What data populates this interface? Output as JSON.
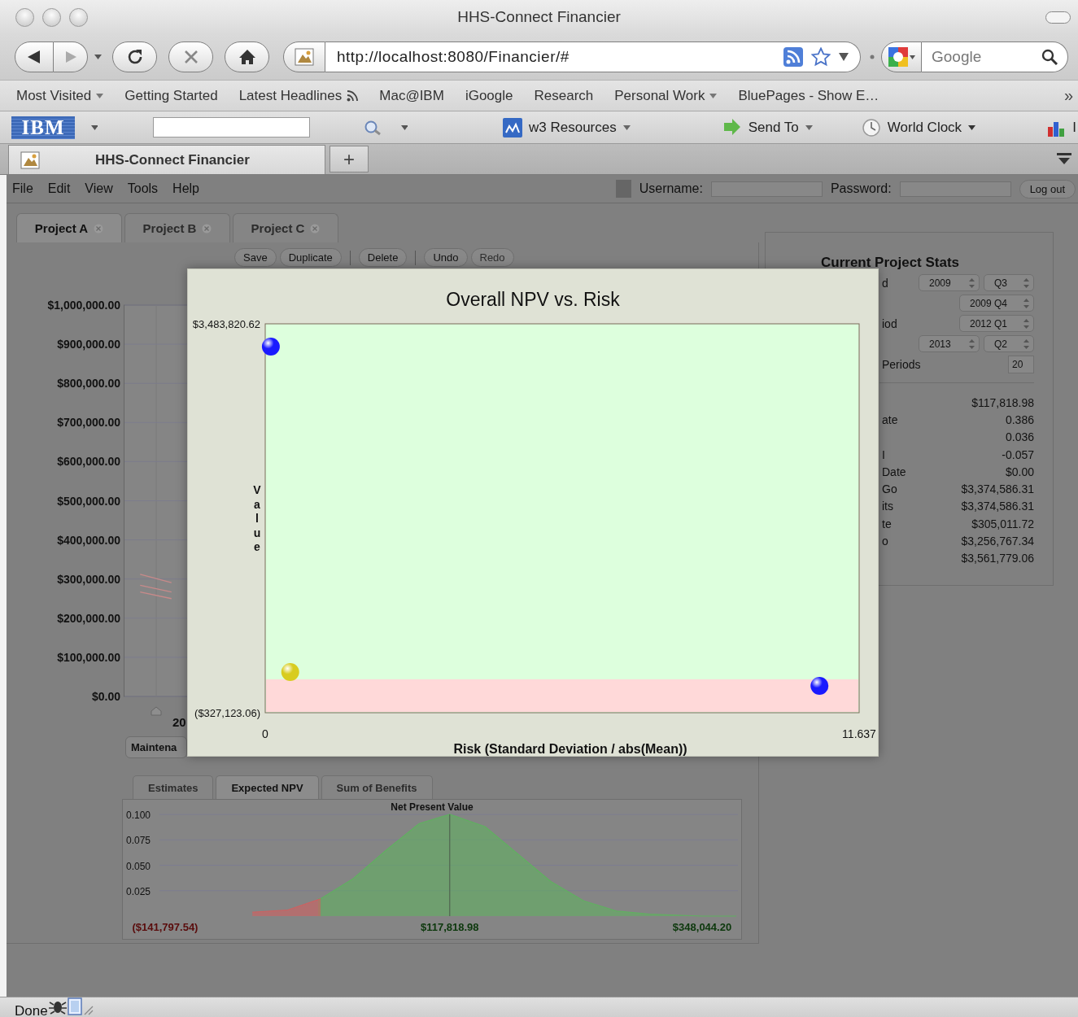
{
  "window": {
    "title": "HHS-Connect Financier"
  },
  "navigation": {
    "url": "http://localhost:8080/Financier/#",
    "search": {
      "placeholder": "Google"
    }
  },
  "bookmarks": [
    {
      "label": "Most Visited",
      "kind": "menu"
    },
    {
      "label": "Getting Started",
      "kind": "link"
    },
    {
      "label": "Latest Headlines",
      "kind": "feed"
    },
    {
      "label": "Mac@IBM",
      "kind": "link"
    },
    {
      "label": "iGoogle",
      "kind": "link"
    },
    {
      "label": "Research",
      "kind": "link"
    },
    {
      "label": "Personal Work",
      "kind": "menu"
    },
    {
      "label": "BluePages - Show E…",
      "kind": "link"
    }
  ],
  "bookmarks_more": "»",
  "ibm_toolbar": {
    "logo": "IBM",
    "items": [
      {
        "label": "w3 Resources",
        "kind": "w3"
      },
      {
        "label": "Send To",
        "kind": "send"
      },
      {
        "label": "World Clock",
        "kind": "clock"
      }
    ],
    "cut_text": "I"
  },
  "tabs": [
    {
      "label": "HHS-Connect Financier",
      "selected": true
    }
  ],
  "new_tab": "+",
  "app": {
    "menu": [
      "File",
      "Edit",
      "View",
      "Tools",
      "Help"
    ],
    "login": {
      "username_label": "Username:",
      "password_label": "Password:",
      "logout": "Log out"
    },
    "projects": [
      {
        "label": "Project A",
        "selected": true
      },
      {
        "label": "Project B",
        "selected": false
      },
      {
        "label": "Project C",
        "selected": false
      }
    ],
    "actions": [
      {
        "kind": "button",
        "label": "Save",
        "disabled": false
      },
      {
        "kind": "button",
        "label": "Duplicate",
        "disabled": false
      },
      {
        "kind": "separator"
      },
      {
        "kind": "button",
        "label": "Delete",
        "disabled": false
      },
      {
        "kind": "separator"
      },
      {
        "kind": "button",
        "label": "Undo",
        "disabled": false
      },
      {
        "kind": "button",
        "label": "Redo",
        "disabled": true
      }
    ],
    "timeline_chart": {
      "chart_data": {
        "type": "line",
        "ylim": [
          0,
          1000000
        ],
        "grid": true,
        "yticks": [
          {
            "value": 1000000,
            "label": "$1,000,000.00"
          },
          {
            "value": 900000,
            "label": "$900,000.00"
          },
          {
            "value": 800000,
            "label": "$800,000.00"
          },
          {
            "value": 700000,
            "label": "$700,000.00"
          },
          {
            "value": 600000,
            "label": "$600,000.00"
          },
          {
            "value": 500000,
            "label": "$500,000.00"
          },
          {
            "value": 400000,
            "label": "$400,000.00"
          },
          {
            "value": 300000,
            "label": "$300,000.00"
          },
          {
            "value": 200000,
            "label": "$200,000.00"
          },
          {
            "value": 100000,
            "label": "$100,000.00"
          },
          {
            "value": 0,
            "label": "$0.00"
          }
        ],
        "series": [
          {
            "color": "#c88a8a",
            "values": [
              312000,
              291000
            ]
          },
          {
            "color": "#c88a8a",
            "values": [
              267000,
              250000
            ]
          },
          {
            "color": "#c88a8a",
            "values": [
              284000,
              267000
            ]
          }
        ]
      },
      "x_label_cut": "20"
    },
    "maintenance_button": "Maintena",
    "result_tabs": [
      {
        "label": "Estimates",
        "selected": false
      },
      {
        "label": "Expected NPV",
        "selected": true
      },
      {
        "label": "Sum of Benefits",
        "selected": false
      }
    ],
    "npv_chart": {
      "chart_data": {
        "type": "area",
        "title": "Net Present Value",
        "grid": true,
        "x": [
          -60000,
          -30000,
          0,
          30000,
          60000,
          90000,
          117818.98,
          150000,
          180000,
          210000,
          240000,
          270000,
          300000,
          348044.2,
          379200
        ],
        "xlim": [
          -177400,
          379200
        ],
        "ylim": [
          0,
          0.1
        ],
        "yticks": [
          {
            "value": 0.1,
            "label": "0.100"
          },
          {
            "value": 0.075,
            "label": "0.075"
          },
          {
            "value": 0.05,
            "label": "0.050"
          },
          {
            "value": 0.025,
            "label": "0.025"
          }
        ],
        "xticks": [
          {
            "value": -141797.54,
            "label": "($141,797.54)"
          },
          {
            "value": 117818.98,
            "label": "$117,818.98"
          },
          {
            "value": 348044.2,
            "label": "$348,044.20"
          }
        ],
        "ref_lines": [
          {
            "axis": "x",
            "value": 117818.98
          }
        ],
        "series": [
          {
            "color": "#d06060",
            "values": [
              0.004,
              0.006,
              0.017,
              null,
              null,
              null,
              null,
              null,
              null,
              null,
              null,
              null,
              null,
              null,
              null
            ]
          },
          {
            "color": "#60b060",
            "values": [
              null,
              null,
              0.017,
              0.037,
              0.065,
              0.091,
              0.1,
              0.088,
              0.061,
              0.034,
              0.015,
              0.005,
              0.002,
              0,
              0
            ]
          }
        ]
      }
    },
    "stats": {
      "title": "Current Project Stats",
      "settings": [
        {
          "kind": "year_quarter",
          "label": "d",
          "year": "2009",
          "quarter": "Q3"
        },
        {
          "kind": "period",
          "value": "2009 Q4"
        },
        {
          "kind": "period",
          "label": "iod",
          "value": "2012 Q1"
        },
        {
          "kind": "year_quarter",
          "year": "2013",
          "quarter": "Q2"
        },
        {
          "kind": "number",
          "label": "Periods",
          "value": "20"
        }
      ],
      "values": [
        {
          "value": "$117,818.98"
        },
        {
          "label": "ate",
          "value": "0.386"
        },
        {
          "value": "0.036"
        },
        {
          "label": "I",
          "value": "-0.057"
        },
        {
          "label": "Date",
          "value": "$0.00"
        },
        {
          "label": "Go",
          "value": "$3,374,586.31"
        },
        {
          "label": "its",
          "value": "$3,374,586.31"
        },
        {
          "label": "te",
          "value": "$305,011.72"
        },
        {
          "label": "o",
          "value": "$3,256,767.34"
        },
        {
          "value": "$3,561,779.06"
        }
      ]
    }
  },
  "risk_chart": {
    "chart_data": {
      "type": "scatter",
      "title": "Overall NPV vs. Risk",
      "xlabel": "Risk (Standard Deviation / abs(Mean))",
      "ylabel": "Value",
      "x": [
        0.11,
        0.49,
        10.86
      ],
      "xlim": [
        0,
        11.637
      ],
      "ylim": [
        -327123.06,
        3483820.62
      ],
      "xticks": [
        {
          "value": 0,
          "label": "0"
        },
        {
          "value": 11.637,
          "label": "11.637"
        }
      ],
      "yticks": [
        {
          "value": 3483820.62,
          "label": "$3,483,820.62"
        },
        {
          "value": -327123.06,
          "label": "($327,123.06)"
        }
      ],
      "series": [
        {
          "color": "#1a1aff",
          "values": [
            3260000,
            null,
            -64000
          ]
        },
        {
          "color": "#d8cc20",
          "values": [
            null,
            71000,
            null
          ]
        }
      ]
    }
  },
  "status_bar": {
    "text": "Done"
  }
}
